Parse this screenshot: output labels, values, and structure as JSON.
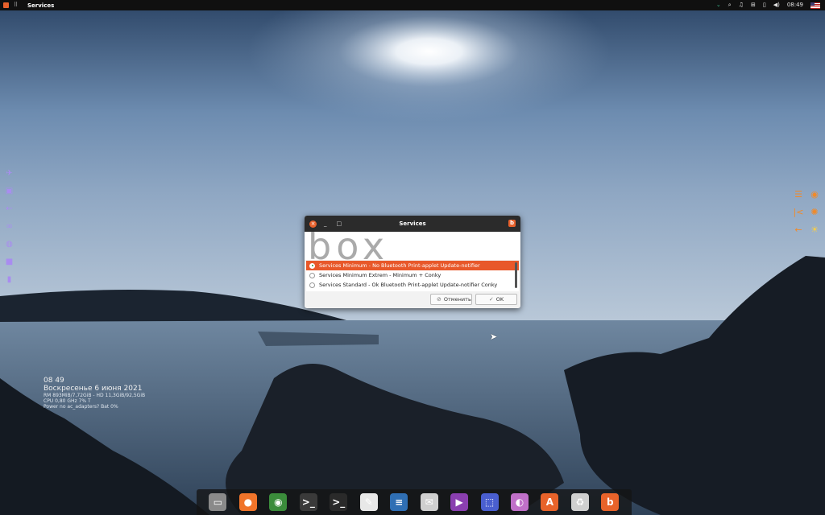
{
  "top_panel": {
    "title": "Services",
    "time": "08:49",
    "icons": [
      "menu-logo-icon",
      "apps-grid-icon",
      "chevron-down-icon",
      "search-icon",
      "notification-bell-icon",
      "network-icon",
      "battery-icon",
      "volume-icon",
      "us-flag-icon"
    ]
  },
  "left_icons": [
    "airplane-icon",
    "window-icon",
    "arrow-left-icon",
    "glasses-icon",
    "globe-icon",
    "lock-icon",
    "chart-bars-icon"
  ],
  "right_icons": [
    "menu-lines-icon",
    "eye-icon",
    "skip-back-icon",
    "gear-icon",
    "arrow-left-icon",
    "weather-sun-icon"
  ],
  "conky": {
    "time": "08 49",
    "date": "Воскресенье  6 июня 2021",
    "ram": "RM 893MiB/7,72GiB - HD 11,3GiB/92,5GiB",
    "cpu": "CPU 0,80 GHz 7% T",
    "power": "Power no ac_adapters? Bat 0%"
  },
  "dialog": {
    "title": "Services",
    "banner_text": "box",
    "options": [
      "Services Minimum - No Bluetooth Print-applet Update-notifier",
      "Services Minimum Extrem - Minimum + Conky",
      "Services Standard - Ok Bluetooth Print-applet Update-notifier Conky"
    ],
    "selected_index": 0,
    "cancel_label": "Отменить",
    "ok_label": "OK"
  },
  "dock": [
    {
      "name": "files",
      "glyph": "▭",
      "color": "#8a8a8a"
    },
    {
      "name": "firefox",
      "glyph": "●",
      "color": "#f0742a"
    },
    {
      "name": "chrome",
      "glyph": "◉",
      "color": "#3b8c3b"
    },
    {
      "name": "terminal",
      "glyph": ">_",
      "color": "#3a3a3a"
    },
    {
      "name": "terminal-alt",
      "glyph": ">_",
      "color": "#2a2a2a"
    },
    {
      "name": "text-editor",
      "glyph": "✎",
      "color": "#e8e8e8"
    },
    {
      "name": "document-writer",
      "glyph": "≡",
      "color": "#2f6fb4"
    },
    {
      "name": "mail",
      "glyph": "✉",
      "color": "#cfcfcf"
    },
    {
      "name": "media-player",
      "glyph": "▶",
      "color": "#8a3fb0"
    },
    {
      "name": "screenshot",
      "glyph": "⬚",
      "color": "#4a5fd0"
    },
    {
      "name": "settings-toggle",
      "glyph": "◐",
      "color": "#c070c8"
    },
    {
      "name": "app-store",
      "glyph": "A",
      "color": "#e8632a"
    },
    {
      "name": "trash",
      "glyph": "♻",
      "color": "#d0d0d0"
    },
    {
      "name": "bunsenlabs",
      "glyph": "b",
      "color": "#e8632a"
    }
  ]
}
